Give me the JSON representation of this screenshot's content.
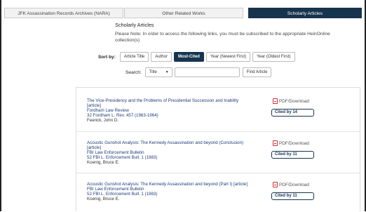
{
  "tabs": [
    {
      "label": "JFK Assassination Records Archives (NARA)"
    },
    {
      "label": "Other Related Works"
    },
    {
      "label": "Scholarly Articles"
    }
  ],
  "section": {
    "heading": "Scholarly Articles",
    "note": "Please Note: In order to access the following links, you must be subscribed to the appropriate HeinOnline collection(s)"
  },
  "sort": {
    "label": "Sort by:",
    "options": [
      "Article Title",
      "Author",
      "Most-Cited",
      "Year (Newest First)",
      "Year (Oldest First)"
    ],
    "active": "Most-Cited"
  },
  "search": {
    "label": "Search:",
    "field_selected": "Title",
    "query": "",
    "button": "Find Article"
  },
  "articles": [
    {
      "title": "The Vice-Presidency and the Problems of Presidential Succession and Inability",
      "type": "[article]",
      "journal": "Fordham Law Review",
      "citation": "32 Fordham L. Rev. 457 (1963-1964)",
      "author": "Feerick, John D.",
      "pdf_label": "PDF/Download",
      "cited_label": "Cited by 14"
    },
    {
      "title": "Acoustic Gunshot Analysis: The Kennedy Assassination and beyond (Conclusion)",
      "type": "[article]",
      "journal": "FBI Law Enforcement Bulletin",
      "citation": "52 FBI L. Enforcement Bull. 1 (1983)",
      "author": "Koenig, Bruce E.",
      "pdf_label": "PDF/Download",
      "cited_label": "Cited by 11"
    },
    {
      "title": "Acoustic Gunshot Analysis: The Kennedy Assassination and beyond (Part I) [article]",
      "type": "",
      "journal": "FBI Law Enforcement Bulletin",
      "citation": "52 FBI L. Enforcement Bull. 1 (1983)",
      "author": "Koenig, Bruce E.",
      "pdf_label": "PDF/Download",
      "cited_label": "Cited by 11"
    }
  ]
}
